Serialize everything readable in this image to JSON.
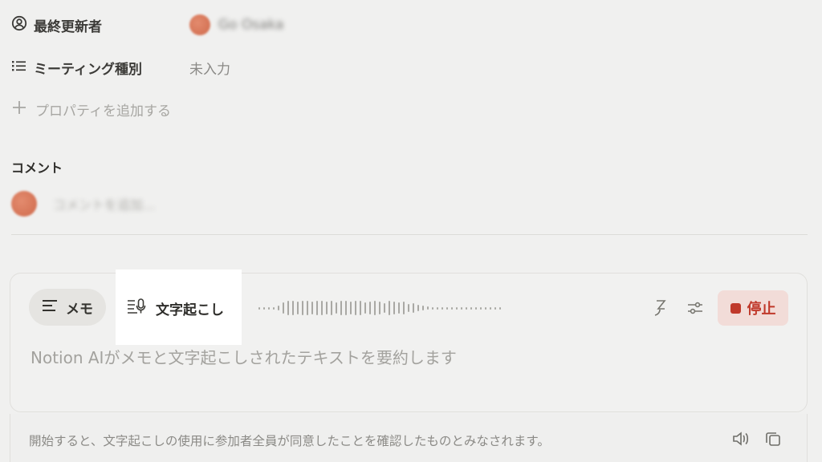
{
  "properties": {
    "last_editor": {
      "label": "最終更新者",
      "value": "Go Osaka"
    },
    "meeting_type": {
      "label": "ミーティング種別",
      "value": "未入力"
    },
    "add_property": "プロパティを追加する"
  },
  "comments": {
    "title": "コメント",
    "placeholder": "コメントを追加..."
  },
  "recorder": {
    "tab_memo": "メモ",
    "tab_transcript": "文字起こし",
    "stop_label": "停止",
    "summary_placeholder": "Notion AIがメモと文字起こしされたテキストを要約します",
    "consent_notice": "開始すると、文字起こしの使用に参加者全員が同意したことを確認したものとみなされます。"
  },
  "icons": {
    "last_editor": "user-circle-icon",
    "meeting_type": "list-icon",
    "add_property": "plus-icon",
    "memo": "align-left-icon",
    "transcript": "transcript-mic-icon",
    "language": "language-icon",
    "settings": "sliders-icon",
    "speaker": "speaker-icon",
    "copy": "copy-icon"
  },
  "colors": {
    "stop": "#c0392b",
    "stop_bg": "#f2dcd8",
    "overlay": "#f0f0ef",
    "highlight": "#ffffff"
  }
}
